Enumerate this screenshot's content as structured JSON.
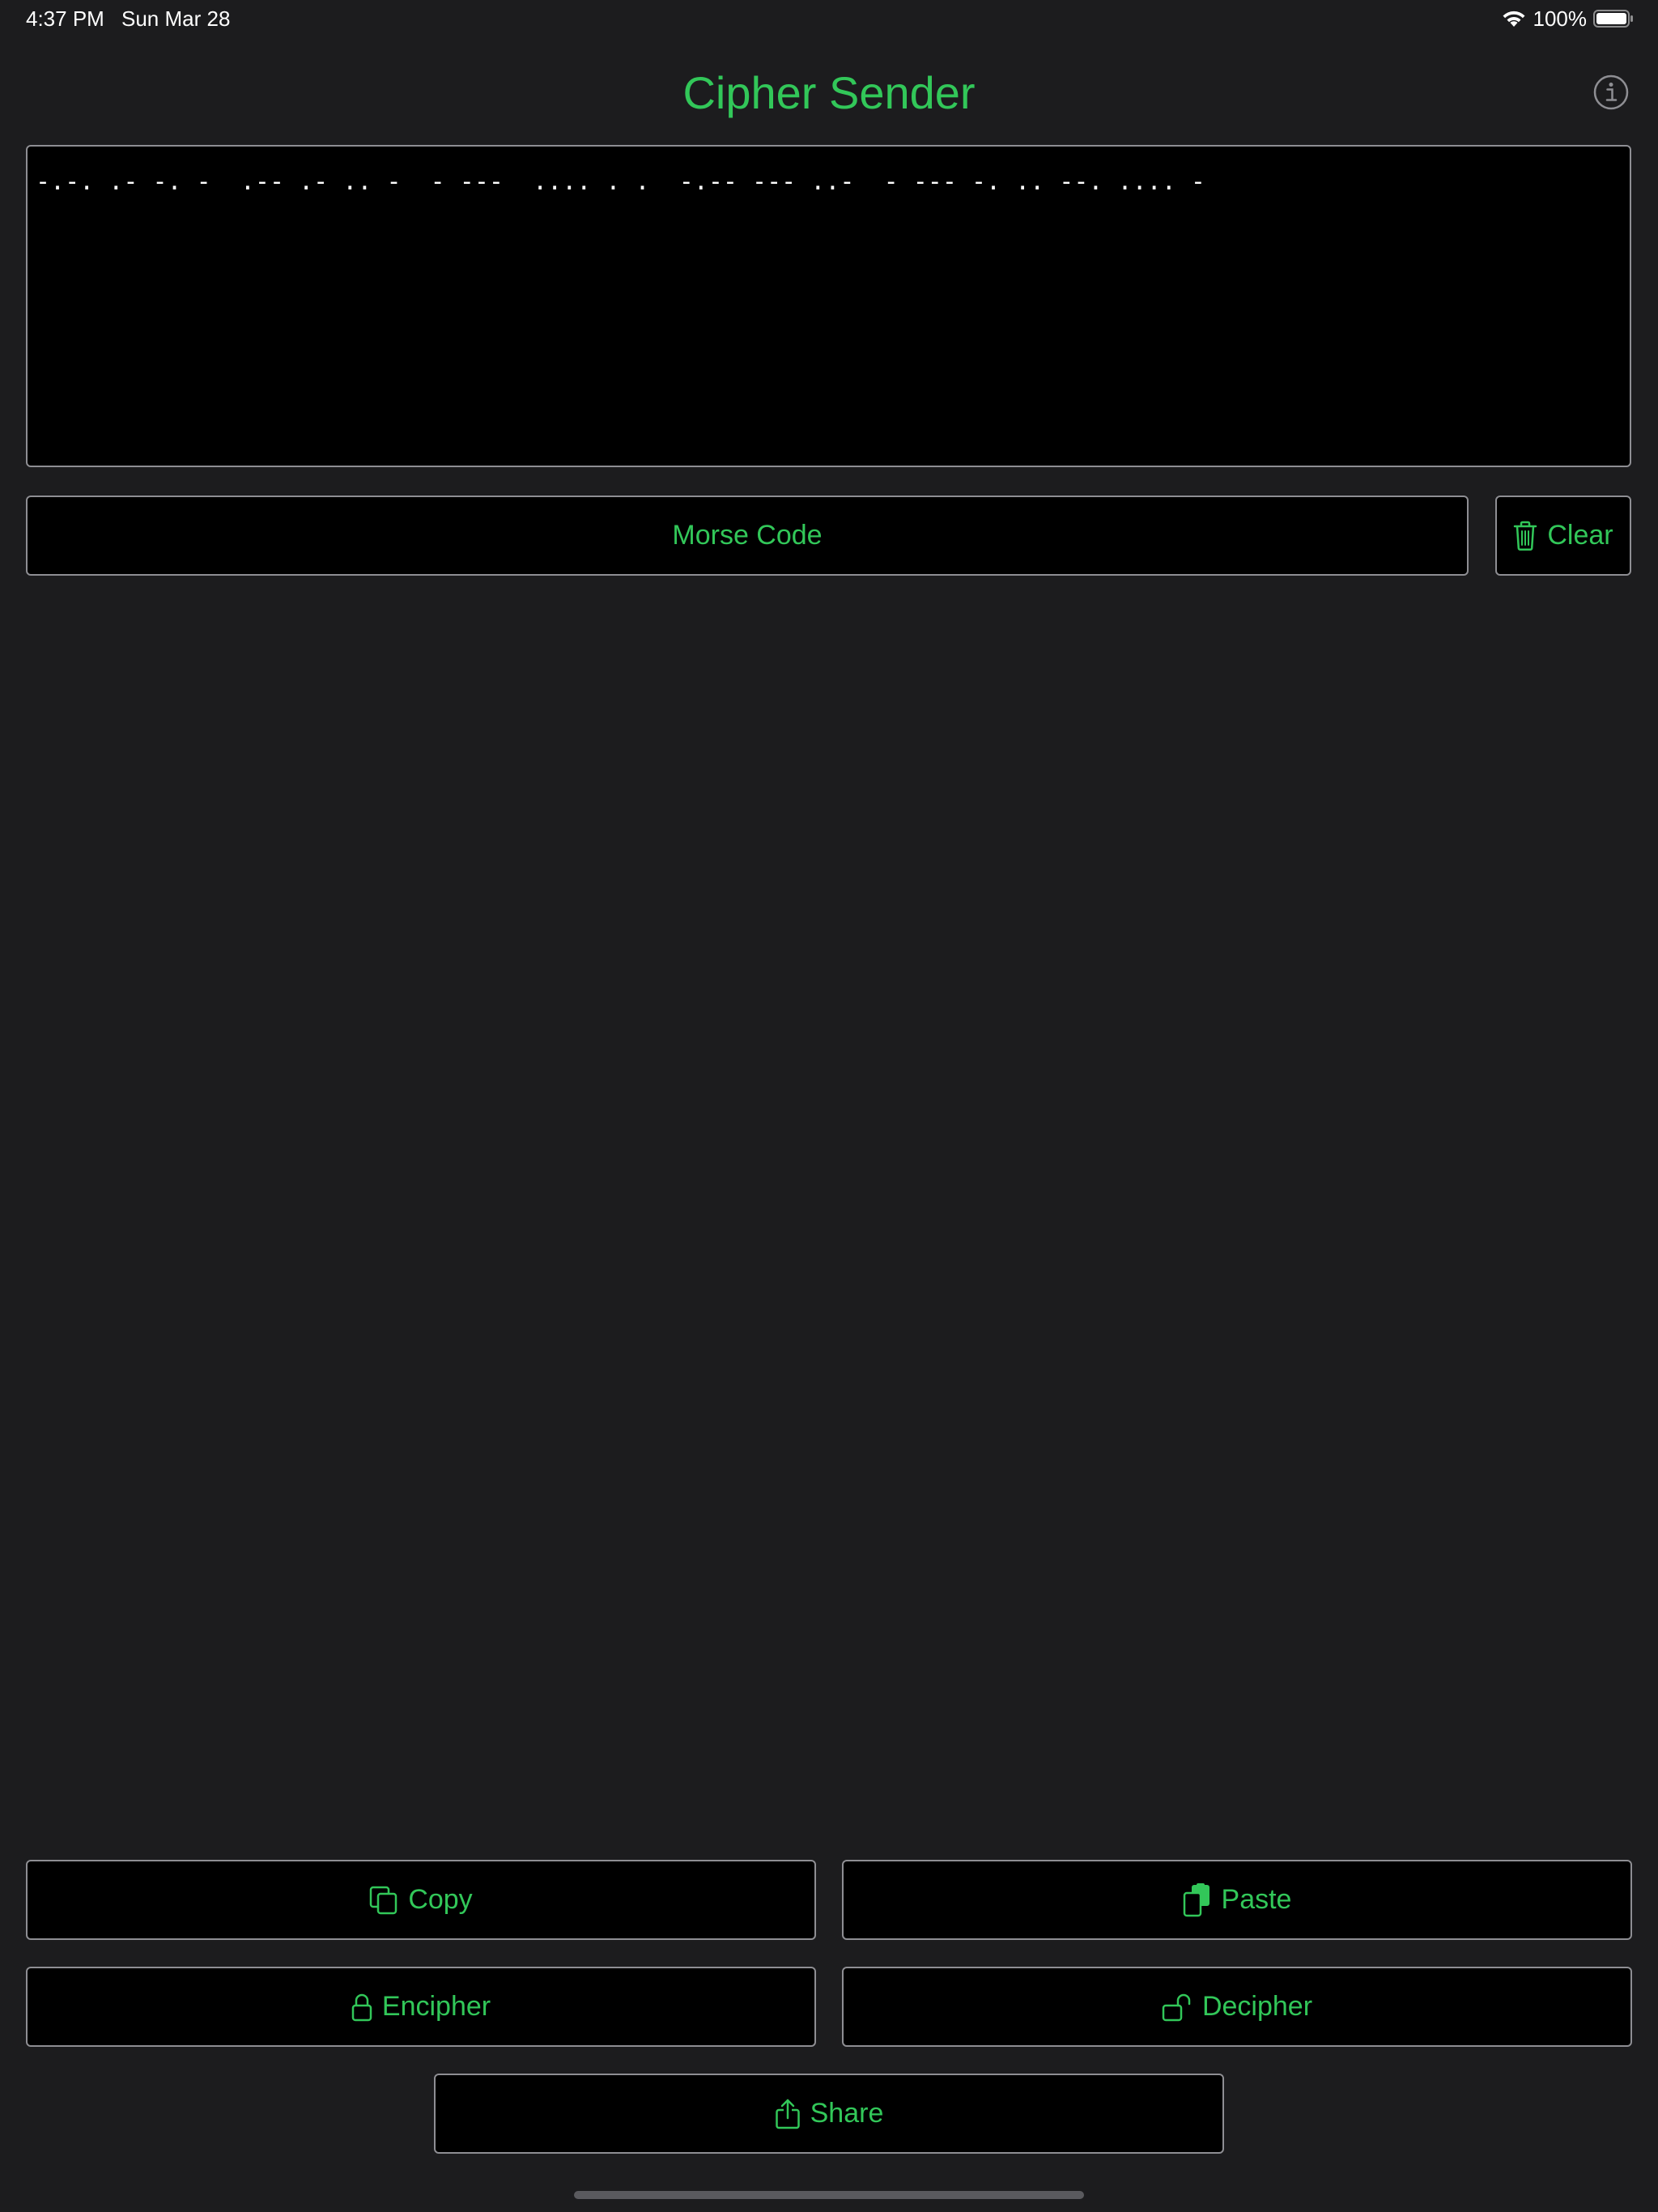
{
  "status_bar": {
    "time": "4:37 PM",
    "date": "Sun Mar 28",
    "battery": "100%"
  },
  "header": {
    "title": "Cipher Sender",
    "info_icon": "info-circle-icon"
  },
  "editor": {
    "text": "-.-. .- -. -  .-- .- .. -  - ---  .... . .  -.-- --- ..-  - --- -. .. --. .... -"
  },
  "cipher_select": {
    "label": "Morse Code"
  },
  "clear_button": {
    "label": "Clear",
    "icon": "trash-icon"
  },
  "actions": {
    "copy": {
      "label": "Copy",
      "icon": "copy-icon"
    },
    "paste": {
      "label": "Paste",
      "icon": "paste-icon"
    },
    "encipher": {
      "label": "Encipher",
      "icon": "lock-icon"
    },
    "decipher": {
      "label": "Decipher",
      "icon": "unlock-icon"
    },
    "share": {
      "label": "Share",
      "icon": "share-icon"
    }
  },
  "colors": {
    "accent": "#32c759",
    "background": "#1c1c1e",
    "field": "#000000",
    "border": "#8e8e93"
  }
}
